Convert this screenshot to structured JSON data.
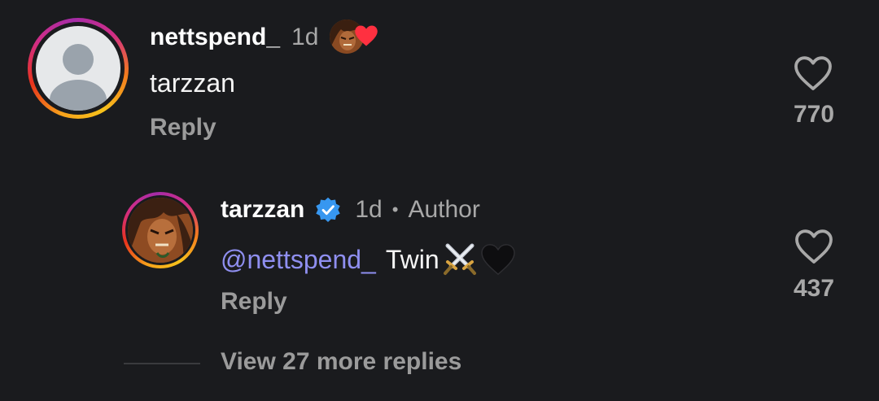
{
  "comment": {
    "username": "nettspend_",
    "time": "1d",
    "text": "tarzzan",
    "reply_label": "Reply",
    "like_count": "770"
  },
  "reply": {
    "username": "tarzzan",
    "time": "1d",
    "separator": "•",
    "author_label": "Author",
    "mention": "@nettspend_",
    "text": "Twin",
    "reply_label": "Reply",
    "like_count": "437"
  },
  "thread": {
    "view_more_label": "View 27 more replies"
  },
  "colors": {
    "background": "#1a1b1e",
    "mention": "#8f8ff0",
    "verified": "#3797f0",
    "muted": "#a8a8a8"
  },
  "icons": [
    "heart-outline-icon",
    "verified-badge-icon",
    "crossed-swords-emoji",
    "black-heart-emoji",
    "creator-liked-heart-icon"
  ]
}
